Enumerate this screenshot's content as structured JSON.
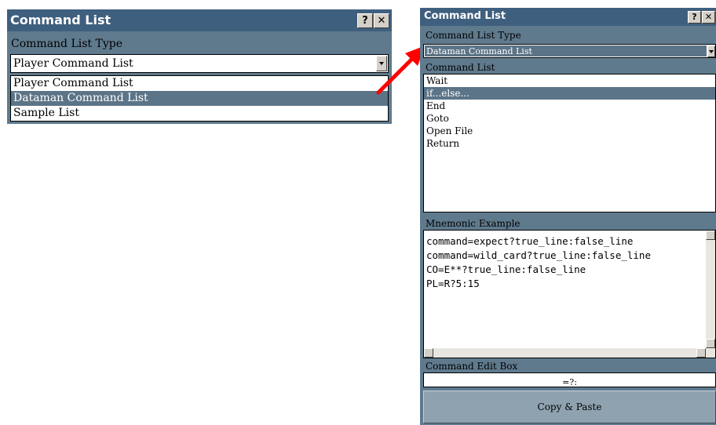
{
  "left_window": {
    "title": "Command List",
    "help_button": "?",
    "close_button": "✕",
    "type_label": "Command List Type",
    "selected_value": "Player Command List",
    "options": [
      {
        "label": "Player Command List",
        "selected": false
      },
      {
        "label": "Dataman Command List",
        "selected": true
      },
      {
        "label": "Sample List",
        "selected": false
      }
    ]
  },
  "right_window": {
    "title": "Command List",
    "help_button": "?",
    "close_button": "✕",
    "type_label": "Command List Type",
    "selected_value": "Dataman Command List",
    "list_label": "Command List",
    "commands": [
      {
        "label": "Wait",
        "selected": false
      },
      {
        "label": "if...else...",
        "selected": true
      },
      {
        "label": "End",
        "selected": false
      },
      {
        "label": "Goto",
        "selected": false
      },
      {
        "label": "Open File",
        "selected": false
      },
      {
        "label": "Return",
        "selected": false
      }
    ],
    "mnemonic_label": "Mnemonic Example",
    "mnemonic_lines": [
      "command=expect?true_line:false_line",
      "command=wild_card?true_line:false_line",
      "CO=E**?true_line:false_line",
      "PL=R?5:15"
    ],
    "edit_label": "Command Edit Box",
    "edit_value": "=?:",
    "copy_button": "Copy & Paste"
  },
  "colors": {
    "titlebar": "#3f5f7e",
    "panel": "#5f7a8d",
    "selection": "#5c7487",
    "arrow": "#ff0000"
  }
}
